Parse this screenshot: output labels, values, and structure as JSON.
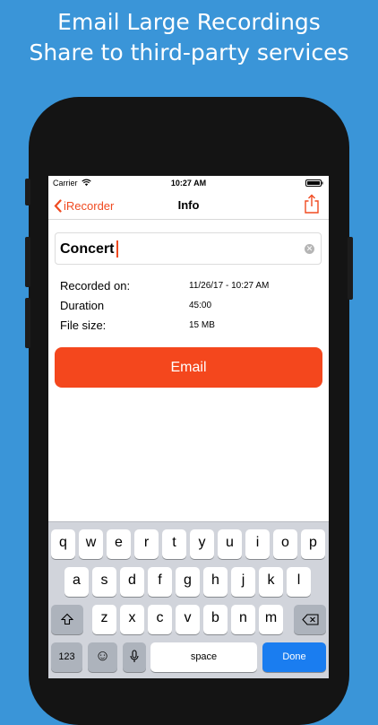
{
  "headline": {
    "line1": "Email Large Recordings",
    "line2": "Share to third-party services"
  },
  "status_bar": {
    "carrier": "Carrier",
    "time": "10:27 AM"
  },
  "nav": {
    "back_label": "iRecorder",
    "title": "Info",
    "back_icon": "chevron-left-icon",
    "share_icon": "share-icon"
  },
  "name_field": {
    "value": "Concert"
  },
  "info_rows": [
    {
      "label": "Recorded on:",
      "value": "11/26/17 - 10:27 AM"
    },
    {
      "label": "Duration",
      "value": "45:00"
    },
    {
      "label": "File size:",
      "value": "15 MB"
    }
  ],
  "email_button": {
    "label": "Email"
  },
  "keyboard": {
    "row1": [
      "q",
      "w",
      "e",
      "r",
      "t",
      "y",
      "u",
      "i",
      "o",
      "p"
    ],
    "row2": [
      "a",
      "s",
      "d",
      "f",
      "g",
      "h",
      "j",
      "k",
      "l"
    ],
    "row3": [
      "z",
      "x",
      "c",
      "v",
      "b",
      "n",
      "m"
    ],
    "numbers_key": "123",
    "space_key": "space",
    "done_key": "Done",
    "emoji_key": "☺",
    "shift_icon": "shift-icon",
    "delete_icon": "delete-icon",
    "mic_icon": "microphone-icon"
  },
  "colors": {
    "background": "#3a95d8",
    "accent": "#f04a20",
    "email_button": "#f4471d",
    "done_key": "#1a7df0"
  }
}
